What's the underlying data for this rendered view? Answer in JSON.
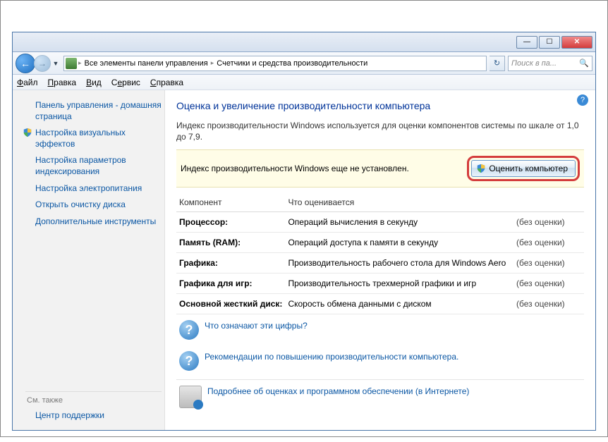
{
  "breadcrumbs": {
    "item1": "Все элементы панели управления",
    "item2": "Счетчики и средства производительности"
  },
  "search": {
    "placeholder": "Поиск в па..."
  },
  "menu": {
    "file": "Файл",
    "edit": "Правка",
    "view": "Вид",
    "tools": "Сервис",
    "help": "Справка"
  },
  "sidebar": {
    "home": "Панель управления - домашняя страница",
    "visual": "Настройка визуальных эффектов",
    "indexing": "Настройка параметров индексирования",
    "power": "Настройка электропитания",
    "cleanup": "Открыть очистку диска",
    "advtools": "Дополнительные инструменты",
    "see_also_label": "См. также",
    "support": "Центр поддержки"
  },
  "page": {
    "title": "Оценка и увеличение производительности компьютера",
    "intro": "Индекс производительности Windows используется для оценки компонентов системы по шкале от 1,0 до 7,9.",
    "notice": "Индекс производительности Windows еще не установлен.",
    "rate_button": "Оценить компьютер"
  },
  "table": {
    "h_component": "Компонент",
    "h_what": "Что оценивается",
    "no_score": "(без оценки)",
    "rows": [
      {
        "label": "Процессор:",
        "what": "Операций вычисления в секунду"
      },
      {
        "label": "Память (RAM):",
        "what": "Операций доступа к памяти в секунду"
      },
      {
        "label": "Графика:",
        "what": "Производительность рабочего стола для Windows Aero"
      },
      {
        "label": "Графика для игр:",
        "what": "Производительность трехмерной графики и игр"
      },
      {
        "label": "Основной жесткий диск:",
        "what": "Скорость обмена данными с диском"
      }
    ]
  },
  "links": {
    "what_numbers": "Что означают эти цифры?",
    "recommend": "Рекомендации по повышению производительности компьютера.",
    "more_info": "Подробнее об оценках и программном обеспечении (в Интернете)"
  }
}
